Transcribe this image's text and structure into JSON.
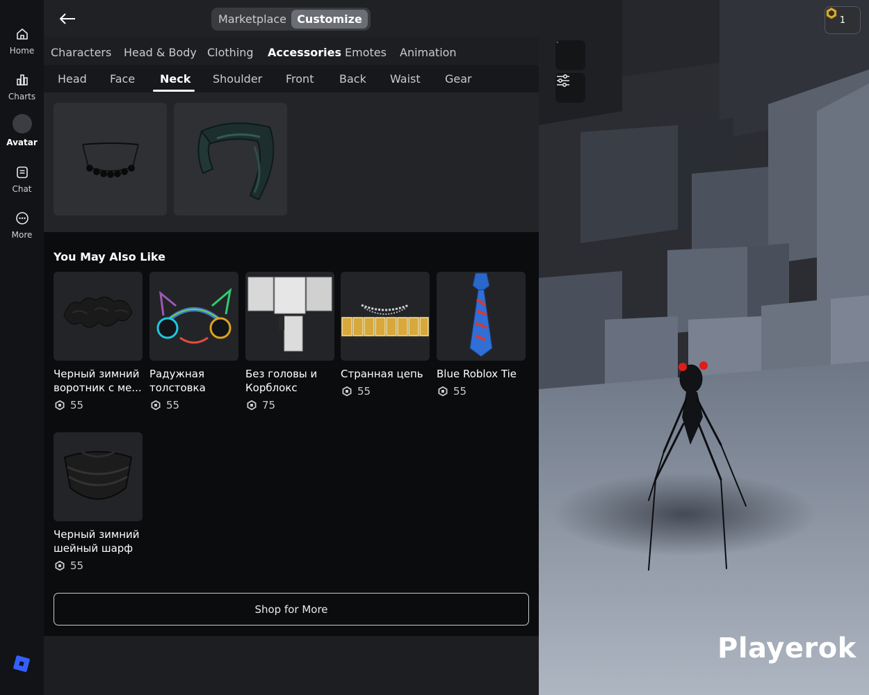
{
  "nav": {
    "items": [
      {
        "label": "Home",
        "icon": "home-icon"
      },
      {
        "label": "Charts",
        "icon": "charts-icon"
      },
      {
        "label": "Avatar",
        "icon": "avatar-icon"
      },
      {
        "label": "Chat",
        "icon": "chat-icon"
      },
      {
        "label": "More",
        "icon": "more-icon"
      }
    ],
    "active": "Avatar"
  },
  "header": {
    "segments": {
      "marketplace": "Marketplace",
      "customize": "Customize"
    },
    "active_segment": "Customize"
  },
  "categories": [
    "Characters",
    "Head & Body",
    "Clothing",
    "Accessories",
    "Emotes",
    "Animation"
  ],
  "active_category": "Accessories",
  "subcategories": [
    "Head",
    "Face",
    "Neck",
    "Shoulder",
    "Front",
    "Back",
    "Waist",
    "Gear"
  ],
  "active_subcategory": "Neck",
  "owned_items": [
    {
      "icon": "black-star-necklace-icon"
    },
    {
      "icon": "dark-teal-scarf-icon"
    }
  ],
  "recommendations": {
    "title": "You May Also Like",
    "items": [
      {
        "name": "Черный зимний воротник с ме...",
        "price": "55"
      },
      {
        "name": "Радужная толстовка",
        "price": "55"
      },
      {
        "name": "Без головы и Корблокс",
        "price": "75"
      },
      {
        "name": "Странная цепь",
        "price": "55"
      },
      {
        "name": "Blue Roblox Tie",
        "price": "55"
      },
      {
        "name": "Черный зимний шейный шарф",
        "price": "55"
      }
    ],
    "shop_button": "Shop for More"
  },
  "scene": {
    "robux_count": "1",
    "watermark": "Playerok"
  },
  "colors": {
    "accent_blue": "#335fff",
    "nav_bg": "#121316",
    "panel_bg": "#1d1e21"
  }
}
